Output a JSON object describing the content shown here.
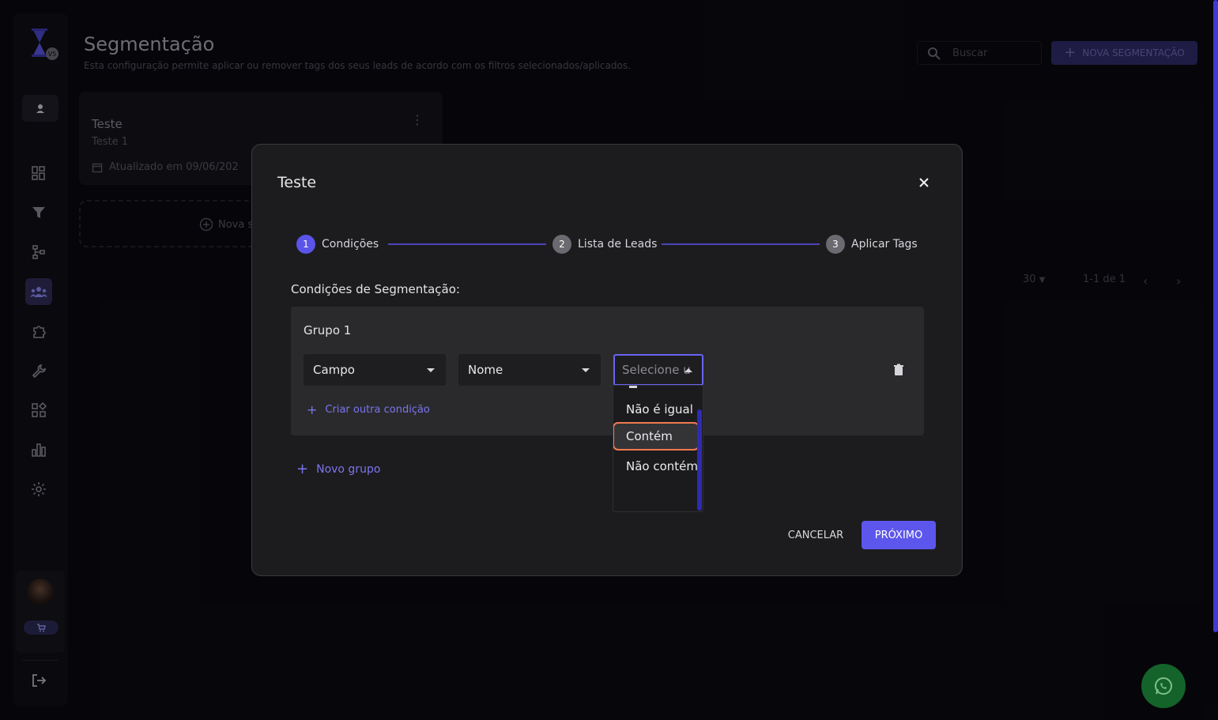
{
  "header": {
    "title": "Segmentação",
    "subtitle": "Esta configuração permite aplicar ou remover tags dos seus leads de acordo com os filtros selecionados/aplicados.",
    "search_placeholder": "Buscar",
    "new_button_label": "NOVA SEGMENTAÇÃO"
  },
  "sidebar": {
    "logo_badge": "V5",
    "items": [
      {
        "icon": "dashboard-icon",
        "active": false
      },
      {
        "icon": "filter-icon",
        "active": false
      },
      {
        "icon": "flow-icon",
        "active": false
      },
      {
        "icon": "people-icon",
        "active": true
      },
      {
        "icon": "puzzle-icon",
        "active": false
      },
      {
        "icon": "wrench-icon",
        "active": false
      },
      {
        "icon": "widgets-icon",
        "active": false
      },
      {
        "icon": "bar-chart-icon",
        "active": false
      },
      {
        "icon": "gear-icon",
        "active": false
      }
    ]
  },
  "card": {
    "title": "Teste",
    "subtitle": "Teste 1",
    "updated": "Atualizado em 09/06/202"
  },
  "add_card_label": "Nova s",
  "pagination": {
    "per_page": "30",
    "range": "1-1 de 1"
  },
  "modal": {
    "title": "Teste",
    "steps": [
      {
        "num": "1",
        "label": "Condições"
      },
      {
        "num": "2",
        "label": "Lista de Leads"
      },
      {
        "num": "3",
        "label": "Aplicar Tags"
      }
    ],
    "section_label": "Condições de Segmentação:",
    "group": {
      "title": "Grupo 1",
      "field_select": "Campo",
      "attribute_select": "Nome",
      "operator_placeholder": "Selecione u",
      "add_condition": "Criar outra condição"
    },
    "new_group": "Novo grupo",
    "cancel_label": "CANCELAR",
    "next_label": "PRÓXIMO",
    "dropdown_options": [
      "Não é igual",
      "Contém",
      "Não contém"
    ],
    "dropdown_highlighted": "Contém"
  },
  "colors": {
    "accent": "#5d56ec",
    "highlight_outline": "#f07a52",
    "whatsapp": "#14632b"
  }
}
